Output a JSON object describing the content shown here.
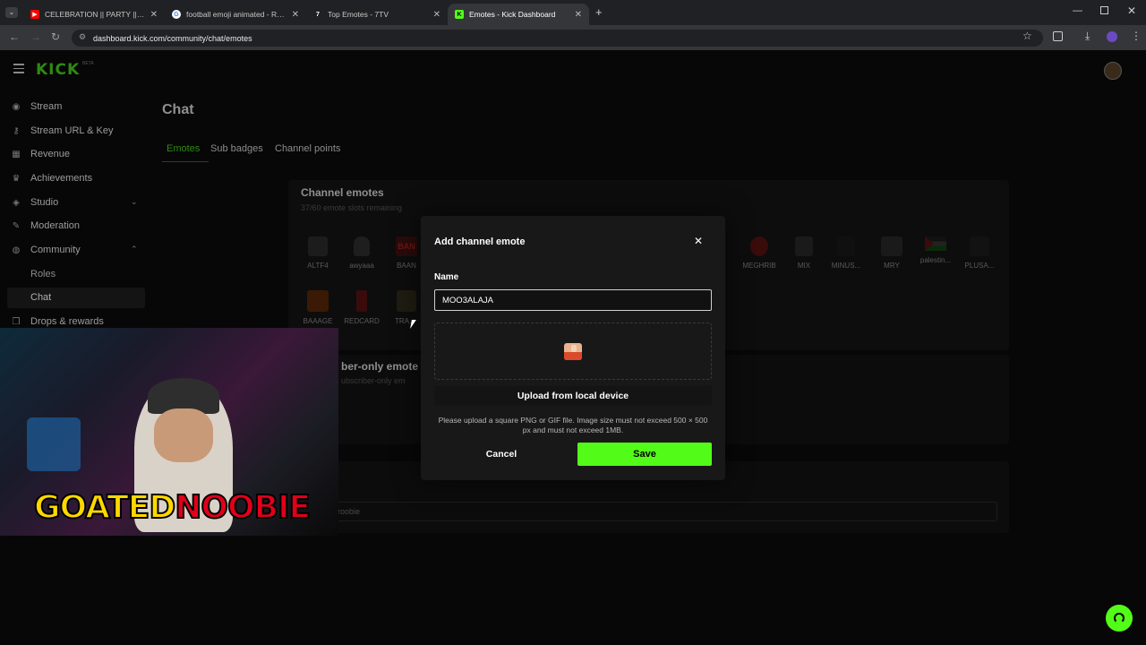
{
  "browser": {
    "tabs": [
      {
        "title": "CELEBRATION || PARTY || CHRO",
        "fav": "yt"
      },
      {
        "title": "football emoji animated - Rech",
        "fav": "g"
      },
      {
        "title": "Top Emotes - 7TV",
        "fav": "7"
      },
      {
        "title": "Emotes - Kick Dashboard",
        "fav": "k"
      }
    ],
    "url": "dashboard.kick.com/community/chat/emotes"
  },
  "brand": {
    "logo": "KICK",
    "beta": "BETA"
  },
  "sidebar": {
    "items": [
      {
        "label": "Stream",
        "icon": "stream-icon"
      },
      {
        "label": "Stream URL & Key",
        "icon": "key-icon"
      },
      {
        "label": "Revenue",
        "icon": "revenue-icon"
      },
      {
        "label": "Achievements",
        "icon": "trophy-icon"
      },
      {
        "label": "Studio",
        "icon": "studio-icon"
      },
      {
        "label": "Moderation",
        "icon": "wrench-icon"
      },
      {
        "label": "Community",
        "icon": "community-icon"
      }
    ],
    "sub_items": [
      "Roles",
      "Chat"
    ],
    "partial": "Drops & rewards"
  },
  "main": {
    "title": "Chat",
    "tabs": [
      "Emotes",
      "Sub badges",
      "Channel points"
    ],
    "channel_emotes_title": "Channel emotes",
    "slots": "37/60 emote slots remaining",
    "emotes_row1": [
      "ALTF4",
      "awyaaa",
      "BAAN",
      "MEGHRIB",
      "MIX",
      "MINUS...",
      "MRY",
      "palestin...",
      "PLUSA..."
    ],
    "emotes_row2": [
      "BAAAGE",
      "REDCARD",
      "TRA..."
    ],
    "sub_title": "ber-only emote",
    "sub_desc": "ubscriber-only em",
    "search_value": "roobie"
  },
  "modal": {
    "title": "Add channel emote",
    "name_label": "Name",
    "name_value": "MOO3ALAJA",
    "upload_label": "Upload from local device",
    "hint": "Please upload a square PNG or GIF file. Image size must not exceed 500 × 500 px and must not exceed 1MB.",
    "cancel": "Cancel",
    "save": "Save"
  },
  "webcam": {
    "overlay_text_a": "GOATED",
    "overlay_text_b": "NOOBIE"
  },
  "colors": {
    "accent": "#53fc18",
    "red": "#e0001a",
    "yellow": "#ffd800"
  }
}
